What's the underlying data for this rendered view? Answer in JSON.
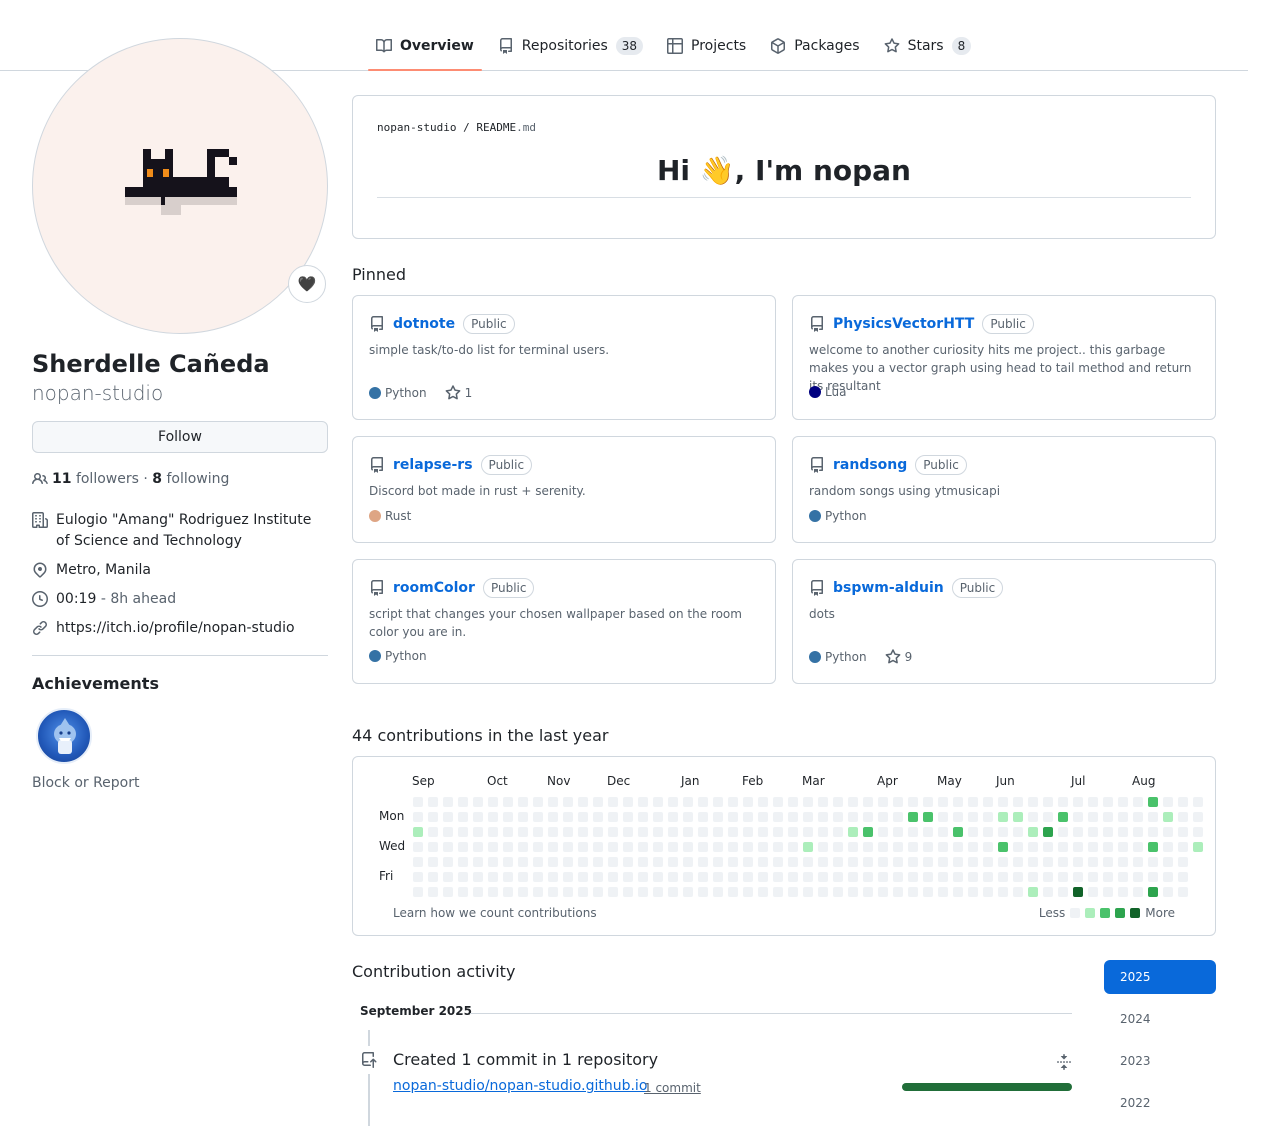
{
  "tabs": [
    {
      "label": "Overview",
      "icon": "book-icon",
      "counter": null,
      "active": true
    },
    {
      "label": "Repositories",
      "icon": "repo-icon",
      "counter": "38",
      "active": false
    },
    {
      "label": "Projects",
      "icon": "table-icon",
      "counter": null,
      "active": false
    },
    {
      "label": "Packages",
      "icon": "package-icon",
      "counter": null,
      "active": false
    },
    {
      "label": "Stars",
      "icon": "star-icon",
      "counter": "8",
      "active": false
    }
  ],
  "profile": {
    "name": "Sherdelle Cañeda",
    "login": "nopan-studio",
    "follow_label": "Follow",
    "followers_count": "11",
    "followers_label": "followers",
    "following_count": "8",
    "following_label": "following",
    "status_emoji": "🖤",
    "organization": "Eulogio \"Amang\" Rodriguez Institute of Science and Technology",
    "location": "Metro, Manila",
    "local_time": "00:19",
    "time_offset": "- 8h ahead",
    "website": "https://itch.io/profile/nopan-studio",
    "achievements_title": "Achievements",
    "block_label": "Block or Report"
  },
  "readme": {
    "owner": "nopan-studio",
    "separator": "/",
    "file": "README",
    "ext": ".md",
    "heading": "Hi 👋, I'm nopan"
  },
  "pinned": {
    "title": "Pinned",
    "repos": [
      {
        "name": "dotnote",
        "visibility": "Public",
        "description": "simple task/to-do list for terminal users.",
        "language": "Python",
        "lang_color": "#3572A5",
        "stars": "1"
      },
      {
        "name": "PhysicsVectorHTT",
        "visibility": "Public",
        "description": "welcome to another curiosity hits me project.. this garbage makes you a vector graph using head to tail method and return its resultant",
        "language": "Lua",
        "lang_color": "#000080",
        "stars": null
      },
      {
        "name": "relapse-rs",
        "visibility": "Public",
        "description": "Discord bot made in rust + serenity.",
        "language": "Rust",
        "lang_color": "#dea584",
        "stars": null
      },
      {
        "name": "randsong",
        "visibility": "Public",
        "description": "random songs using ytmusicapi",
        "language": "Python",
        "lang_color": "#3572A5",
        "stars": null
      },
      {
        "name": "roomColor",
        "visibility": "Public",
        "description": "script that changes your chosen wallpaper based on the room color you are in.",
        "language": "Python",
        "lang_color": "#3572A5",
        "stars": null
      },
      {
        "name": "bspwm-alduin",
        "visibility": "Public",
        "description": "dots",
        "language": "Python",
        "lang_color": "#3572A5",
        "stars": "9"
      }
    ]
  },
  "contributions": {
    "title": "44 contributions in the last year",
    "months": [
      "Sep",
      "Oct",
      "Nov",
      "Dec",
      "Jan",
      "Feb",
      "Mar",
      "Apr",
      "May",
      "Jun",
      "Jul",
      "Aug"
    ],
    "days": [
      "Mon",
      "Wed",
      "Fri"
    ],
    "learn_label": "Learn how we count contributions",
    "less_label": "Less",
    "more_label": "More",
    "level_colors": [
      "#eff2f5",
      "#aceebb",
      "#4ac26b",
      "#2da44e",
      "#116329"
    ],
    "weeks": 53,
    "cells": [
      {
        "w": 0,
        "d": 2,
        "l": 1
      },
      {
        "w": 26,
        "d": 3,
        "l": 1
      },
      {
        "w": 29,
        "d": 2,
        "l": 1
      },
      {
        "w": 30,
        "d": 2,
        "l": 2
      },
      {
        "w": 33,
        "d": 1,
        "l": 2
      },
      {
        "w": 34,
        "d": 1,
        "l": 2
      },
      {
        "w": 36,
        "d": 2,
        "l": 2
      },
      {
        "w": 39,
        "d": 1,
        "l": 1
      },
      {
        "w": 39,
        "d": 3,
        "l": 2
      },
      {
        "w": 40,
        "d": 1,
        "l": 1
      },
      {
        "w": 41,
        "d": 2,
        "l": 1
      },
      {
        "w": 41,
        "d": 6,
        "l": 1
      },
      {
        "w": 42,
        "d": 2,
        "l": 3
      },
      {
        "w": 43,
        "d": 1,
        "l": 2
      },
      {
        "w": 44,
        "d": 6,
        "l": 4
      },
      {
        "w": 49,
        "d": 0,
        "l": 2
      },
      {
        "w": 49,
        "d": 3,
        "l": 2
      },
      {
        "w": 49,
        "d": 6,
        "l": 3
      },
      {
        "w": 50,
        "d": 1,
        "l": 1
      },
      {
        "w": 52,
        "d": 3,
        "l": 1
      }
    ]
  },
  "activity": {
    "title": "Contribution activity",
    "years": [
      "2025",
      "2024",
      "2023",
      "2022"
    ],
    "active_year": "2025",
    "month": "September 2025",
    "headline": "Created 1 commit in 1 repository",
    "repo": "nopan-studio/nopan-studio.github.io",
    "count": "1 commit"
  }
}
